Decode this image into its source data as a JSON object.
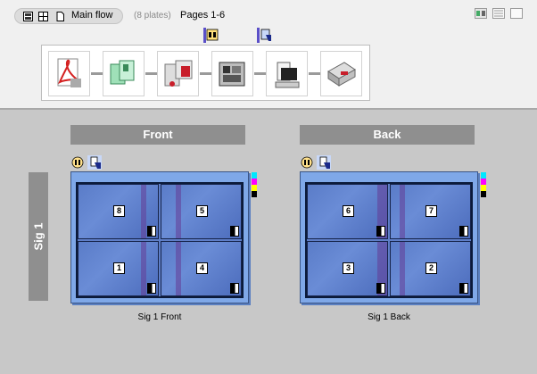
{
  "toolbar": {
    "flow_name": "Main flow",
    "plates_count": "(8 plates)",
    "pages_range": "Pages 1-6",
    "icons": [
      "sheet-view-icon",
      "grid-view-icon",
      "page-icon"
    ],
    "view_icons": [
      "thumbnail-view-icon",
      "list-view-icon",
      "single-view-icon"
    ]
  },
  "flow": {
    "toggles": [
      "front-sheet-toggle-icon",
      "back-sheet-toggle-icon"
    ],
    "steps": [
      "pdf-input-step",
      "imposition-step",
      "color-management-step",
      "rip-step",
      "proof-step",
      "output-printer-step"
    ]
  },
  "signature": {
    "label": "Sig 1",
    "sides": [
      {
        "header": "Front",
        "caption": "Sig 1 Front",
        "pages": [
          "8",
          "5",
          "1",
          "4"
        ]
      },
      {
        "header": "Back",
        "caption": "Sig 1 Back",
        "pages": [
          "6",
          "7",
          "3",
          "2"
        ]
      }
    ],
    "cmyk_colors": [
      "#00e8ff",
      "#ff00ff",
      "#ffff00",
      "#000000"
    ]
  }
}
